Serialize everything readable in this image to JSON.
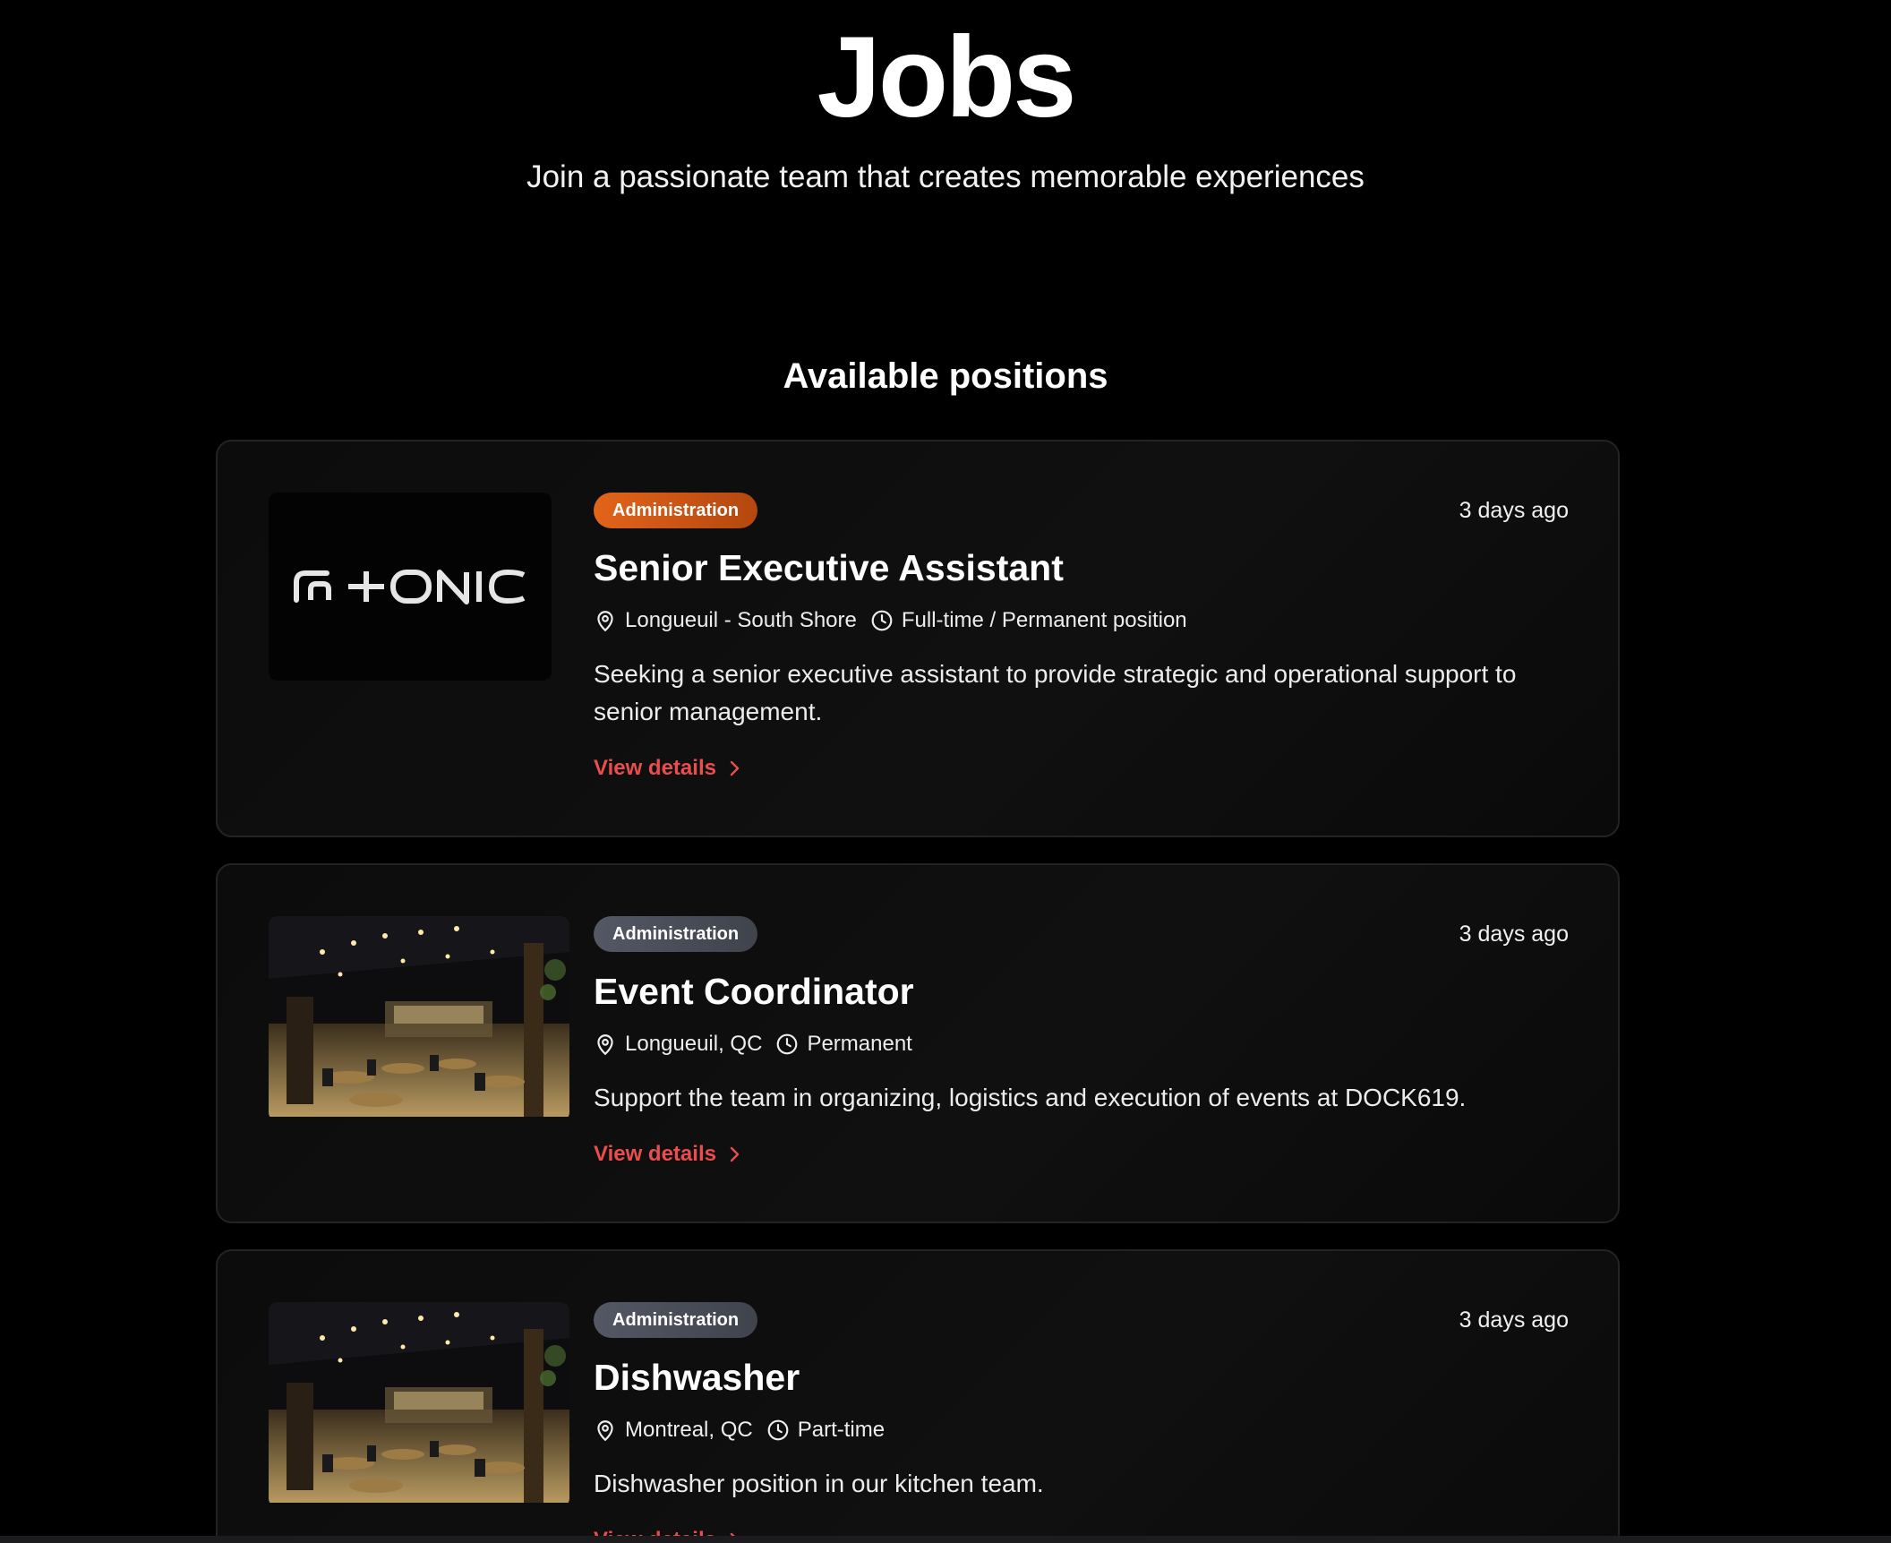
{
  "hero": {
    "title": "Jobs",
    "subtitle": "Join a passionate team that creates memorable experiences"
  },
  "section": {
    "title": "Available positions"
  },
  "colors": {
    "badge_orange": "#e3641a",
    "badge_grey": "#4a4e58",
    "link": "#ea4d4d",
    "background": "#000000"
  },
  "jobs": [
    {
      "category": "Administration",
      "badge_style": "orange",
      "posted": "3 days ago",
      "title": "Senior Executive Assistant",
      "location": "Longueuil - South Shore",
      "schedule": "Full-time / Permanent position",
      "description": "Seeking a senior executive assistant to provide strategic and operational support to senior management.",
      "link_label": "View details",
      "thumbnail": "tonic-logo",
      "thumbnail_logo_text": "G+ONIC"
    },
    {
      "category": "Administration",
      "badge_style": "grey",
      "posted": "3 days ago",
      "title": "Event Coordinator",
      "location": "Longueuil, QC",
      "schedule": "Permanent",
      "description": "Support the team in organizing, logistics and execution of events at DOCK619.",
      "link_label": "View details",
      "thumbnail": "restaurant-photo"
    },
    {
      "category": "Administration",
      "badge_style": "grey",
      "posted": "3 days ago",
      "title": "Dishwasher",
      "location": "Montreal, QC",
      "schedule": "Part-time",
      "description": "Dishwasher position in our kitchen team.",
      "link_label": "View details",
      "thumbnail": "restaurant-photo"
    }
  ]
}
